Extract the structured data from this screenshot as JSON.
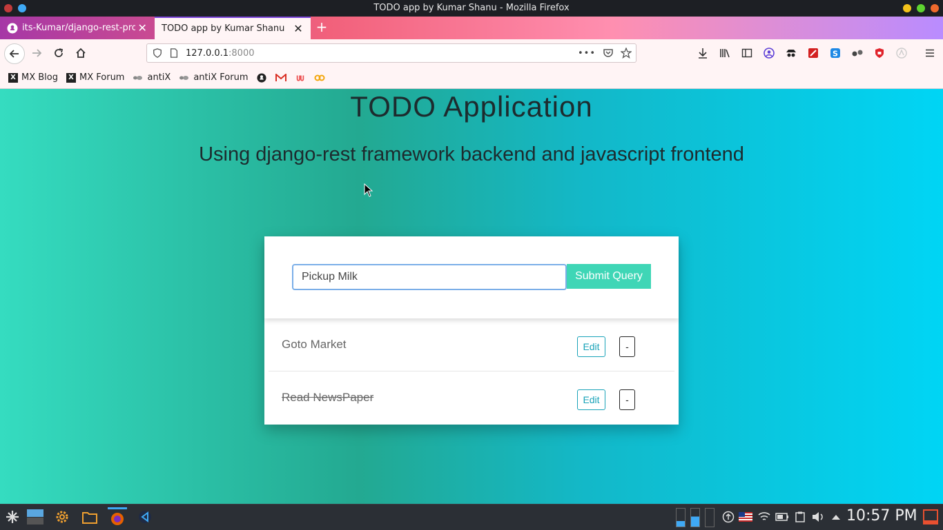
{
  "window": {
    "title": "TODO app by Kumar Shanu - Mozilla Firefox"
  },
  "tabs": [
    {
      "label": "its-Kumar/django-rest-pro"
    },
    {
      "label": "TODO app by Kumar Shanu"
    }
  ],
  "url": {
    "host": "127.0.0.1",
    "port": ":8000"
  },
  "bookmarks": [
    {
      "label": "MX Blog"
    },
    {
      "label": "MX Forum"
    },
    {
      "label": "antiX"
    },
    {
      "label": "antiX Forum"
    }
  ],
  "page": {
    "title": "TODO Application",
    "subtitle": "Using django-rest framework backend and javascript frontend"
  },
  "form": {
    "input_value": "Pickup Milk",
    "submit_label": "Submit Query"
  },
  "todos": [
    {
      "title": "Goto Market",
      "completed": false,
      "edit_label": "Edit",
      "delete_label": "-"
    },
    {
      "title": "Read NewsPaper",
      "completed": true,
      "edit_label": "Edit",
      "delete_label": "-"
    }
  ],
  "taskbar": {
    "clock": "10:57 PM"
  },
  "colors": {
    "accent": "#3fd6b6",
    "edit": "#17a2b8",
    "gradient_left": "#35dcc0",
    "gradient_right": "#00d5f5"
  }
}
